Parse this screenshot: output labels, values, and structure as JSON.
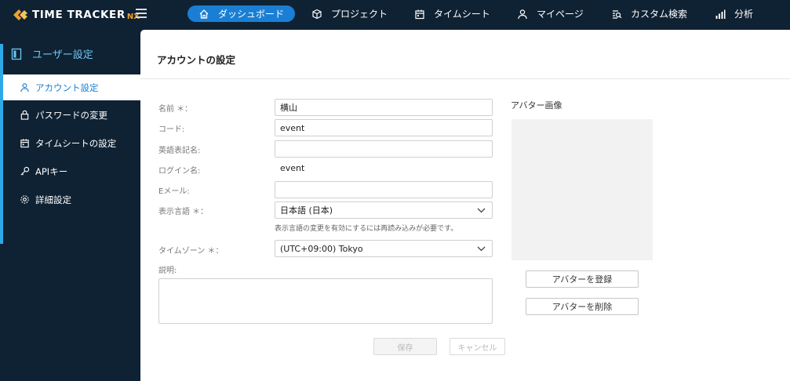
{
  "app": {
    "logo_text": "TIME TRACKER",
    "logo_suffix": "NX"
  },
  "nav": {
    "items": [
      {
        "label": "ダッシュボード",
        "icon": "home-icon",
        "active": true
      },
      {
        "label": "プロジェクト",
        "icon": "cube-icon"
      },
      {
        "label": "タイムシート",
        "icon": "calendar-icon"
      },
      {
        "label": "マイページ",
        "icon": "user-icon"
      },
      {
        "label": "カスタム検索",
        "icon": "search-list-icon"
      },
      {
        "label": "分析",
        "icon": "bar-chart-icon"
      }
    ]
  },
  "sidebar": {
    "header": "ユーザー設定",
    "items": [
      {
        "label": "アカウント設定",
        "icon": "user-icon",
        "active": true
      },
      {
        "label": "パスワードの変更",
        "icon": "lock-icon"
      },
      {
        "label": "タイムシートの設定",
        "icon": "calendar-icon"
      },
      {
        "label": "APIキー",
        "icon": "key-icon"
      },
      {
        "label": "詳細設定",
        "icon": "gear-icon"
      }
    ]
  },
  "page": {
    "title": "アカウントの設定"
  },
  "form": {
    "name_label": "名前 ＊：",
    "name_value": "横山",
    "code_label": "コード:",
    "code_value": "event",
    "english_name_label": "英語表記名:",
    "english_name_value": "",
    "login_label": "ログイン名:",
    "login_value": "event",
    "email_label": "Eメール:",
    "email_value": "",
    "language_label": "表示言語 ＊：",
    "language_value": "日本語 (日本)",
    "language_hint": "表示言語の変更を有効にするには再読み込みが必要です。",
    "timezone_label": "タイムゾーン ＊：",
    "timezone_value": "(UTC+09:00) Tokyo",
    "description_label": "説明:",
    "description_value": ""
  },
  "avatar": {
    "title": "アバター画像",
    "register_label": "アバターを登録",
    "delete_label": "アバターを削除"
  },
  "actions": {
    "save_label": "保存",
    "cancel_label": "キャンセル"
  },
  "colors": {
    "background": "#0f2233",
    "accent": "#1a7fd4",
    "sidebar_accent": "#2fa8e8",
    "logo_orange": "#f0a030"
  }
}
